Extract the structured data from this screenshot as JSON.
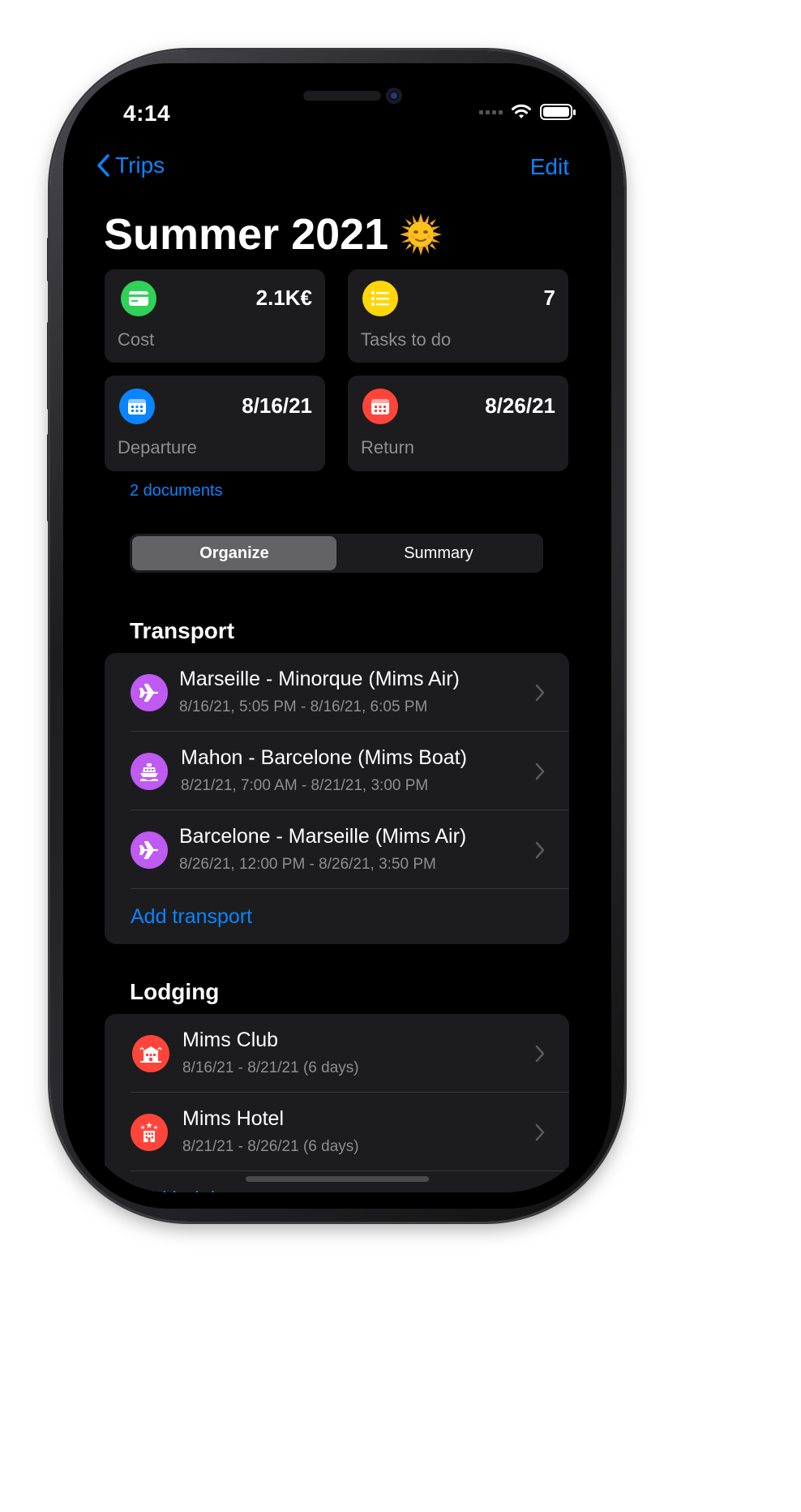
{
  "status_bar": {
    "time": "4:14"
  },
  "nav": {
    "back_label": "Trips",
    "edit_label": "Edit"
  },
  "trip": {
    "title": "Summer 2021",
    "title_emoji": "sun-with-face-icon"
  },
  "stats": {
    "cost": {
      "value": "2.1K€",
      "label": "Cost",
      "icon": "credit-card-icon",
      "color": "#30d158"
    },
    "tasks": {
      "value": "7",
      "label": "Tasks to do",
      "icon": "list-icon",
      "color": "#ffd60a"
    },
    "departure": {
      "value": "8/16/21",
      "label": "Departure",
      "icon": "calendar-icon",
      "color": "#0a84ff"
    },
    "return": {
      "value": "8/26/21",
      "label": "Return",
      "icon": "calendar-icon",
      "color": "#ff453a"
    }
  },
  "documents_link": "2 documents",
  "segments": {
    "organize": "Organize",
    "summary": "Summary",
    "selected": "Organize"
  },
  "transport": {
    "header": "Transport",
    "items": [
      {
        "title": "Marseille - Minorque (Mims Air)",
        "subtitle": "8/16/21, 5:05 PM - 8/16/21, 6:05 PM",
        "icon": "airplane-icon",
        "color": "#bf5af2"
      },
      {
        "title": "Mahon - Barcelone (Mims Boat)",
        "subtitle": "8/21/21, 7:00 AM - 8/21/21, 3:00 PM",
        "icon": "ferry-icon",
        "color": "#bf5af2"
      },
      {
        "title": "Barcelone - Marseille (Mims Air)",
        "subtitle": "8/26/21, 12:00 PM - 8/26/21, 3:50 PM",
        "icon": "airplane-icon",
        "color": "#bf5af2"
      }
    ],
    "add_label": "Add transport"
  },
  "lodging": {
    "header": "Lodging",
    "items": [
      {
        "title": "Mims Club",
        "subtitle": "8/16/21 - 8/21/21 (6 days)",
        "icon": "resort-icon",
        "color": "#ff453a"
      },
      {
        "title": "Mims Hotel",
        "subtitle": "8/21/21 - 8/26/21 (6 days)",
        "icon": "hotel-icon",
        "color": "#ff453a"
      }
    ],
    "add_label": "Add lodging"
  }
}
